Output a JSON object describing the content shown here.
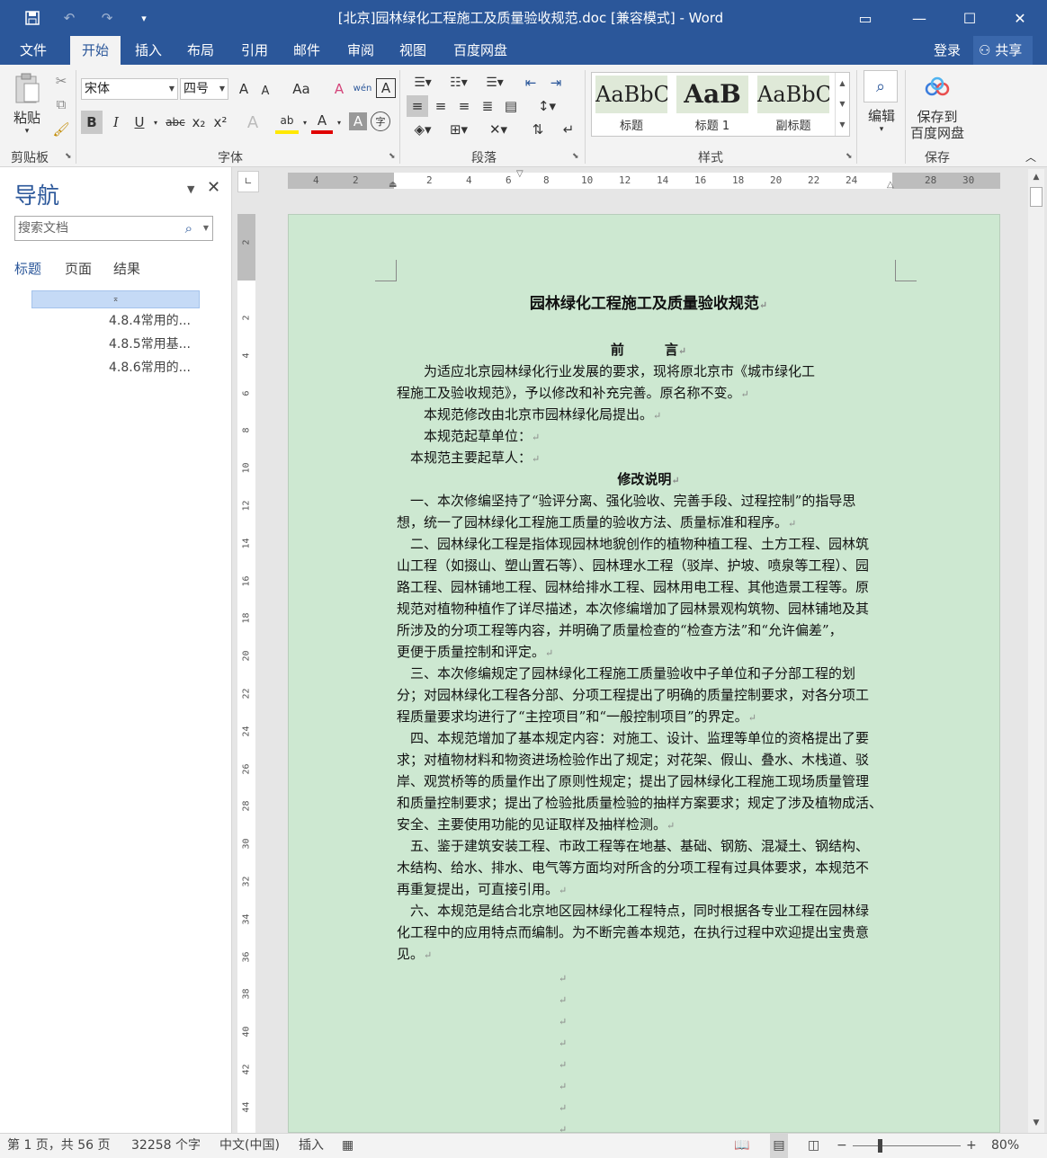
{
  "window": {
    "title": "[北京]园林绿化工程施工及质量验收规范.doc [兼容模式] - Word",
    "save_icon": "save-icon",
    "undo": "↶",
    "redo": "↷",
    "customize": "▾",
    "ribbon_display": "▭",
    "minimize": "—",
    "maximize": "☐",
    "close": "✕"
  },
  "tabs": [
    "文件",
    "开始",
    "插入",
    "布局",
    "引用",
    "邮件",
    "审阅",
    "视图",
    "百度网盘"
  ],
  "account": {
    "signin": "登录",
    "share": "共享"
  },
  "ribbon": {
    "clipboard": {
      "paste": "粘贴",
      "label": "剪贴板"
    },
    "font": {
      "font_name": "宋体",
      "font_size": "四号",
      "label": "字体",
      "grow": "A",
      "shrink": "A",
      "change_case": "Aa",
      "clear": "A",
      "phonetic": "wén",
      "border": "A",
      "bold": "B",
      "italic": "I",
      "underline": "U",
      "strike": "abc",
      "sub": "x₂",
      "sup": "x²",
      "effects": "A",
      "highlight": "ab",
      "color": "A",
      "shading": "A",
      "enclose": "字"
    },
    "paragraph": {
      "label": "段落"
    },
    "styles": {
      "label": "样式",
      "items": [
        {
          "preview": "AaBbC",
          "name": "标题"
        },
        {
          "preview": "AaB",
          "name": "标题 1"
        },
        {
          "preview": "AaBbC",
          "name": "副标题"
        }
      ]
    },
    "editing": {
      "label": "编辑"
    },
    "save": {
      "line1": "保存到",
      "line2": "百度网盘",
      "label": "保存"
    }
  },
  "nav": {
    "title": "导航",
    "search_placeholder": "搜索文档",
    "tabs": [
      "标题",
      "页面",
      "结果"
    ],
    "items": [
      "4.8.4常用的...",
      "4.8.5常用基...",
      "4.8.6常用的..."
    ]
  },
  "ruler": {
    "h_labels": [
      "4",
      "2",
      "2",
      "4",
      "6",
      "8",
      "10",
      "12",
      "14",
      "16",
      "18",
      "20",
      "22",
      "24",
      "28",
      "30"
    ],
    "v_labels": [
      "2",
      "2",
      "4",
      "6",
      "8",
      "10",
      "12",
      "14",
      "16",
      "18",
      "20",
      "22",
      "24",
      "26",
      "28",
      "30",
      "32",
      "34",
      "36",
      "38",
      "40",
      "42",
      "44"
    ]
  },
  "document": {
    "title": "园林绿化工程施工及质量验收规范",
    "lines": [
      "前　　　言",
      "　　为适应北京园林绿化行业发展的要求，现将原北京市《城市绿化工",
      "程施工及验收规范》，予以修改和补充完善。原名称不变。",
      "　　本规范修改由北京市园林绿化局提出。",
      "　　本规范起草单位：",
      "　本规范主要起草人：",
      "修改说明",
      "　一、本次修编坚持了“验评分离、强化验收、完善手段、过程控制”的指导思",
      "想，统一了园林绿化工程施工质量的验收方法、质量标准和程序。",
      "　二、园林绿化工程是指体现园林地貌创作的植物种植工程、土方工程、园林筑",
      "山工程（如掇山、塑山置石等）、园林理水工程（驳岸、护坡、喷泉等工程）、园",
      "路工程、园林铺地工程、园林给排水工程、园林用电工程、其他造景工程等。原",
      "规范对植物种植作了详尽描述，本次修编增加了园林景观构筑物、园林铺地及其",
      "所涉及的分项工程等内容，并明确了质量检查的“检查方法”和“允许偏差”，",
      "更便于质量控制和评定。",
      "　三、本次修编规定了园林绿化工程施工质量验收中子单位和子分部工程的划",
      "分；对园林绿化工程各分部、分项工程提出了明确的质量控制要求，对各分项工",
      "程质量要求均进行了“主控项目”和“一般控制项目”的界定。",
      "　四、本规范增加了基本规定内容：对施工、设计、监理等单位的资格提出了要",
      "求；对植物材料和物资进场检验作出了规定；对花架、假山、叠水、木栈道、驳",
      "岸、观赏桥等的质量作出了原则性规定；提出了园林绿化工程施工现场质量管理",
      "和质量控制要求；提出了检验批质量检验的抽样方案要求；规定了涉及植物成活、",
      "安全、主要使用功能的见证取样及抽样检测。",
      "　五、鉴于建筑安装工程、市政工程等在地基、基础、钢筋、混凝土、钢结构、",
      "木结构、给水、排水、电气等方面均对所含的分项工程有过具体要求，本规范不",
      "再重复提出，可直接引用。",
      "　六、本规范是结合北京地区园林绿化工程特点，同时根据各专业工程在园林绿",
      "化工程中的应用特点而编制。为不断完善本规范，在执行过程中欢迎提出宝贵意",
      "见。"
    ],
    "para_mark": "↵"
  },
  "status": {
    "page": "第 1 页，共 56 页",
    "words": "32258 个字",
    "language": "中文(中国)",
    "mode": "插入",
    "zoom_pct": "80%",
    "zoom_level": 0.8
  }
}
